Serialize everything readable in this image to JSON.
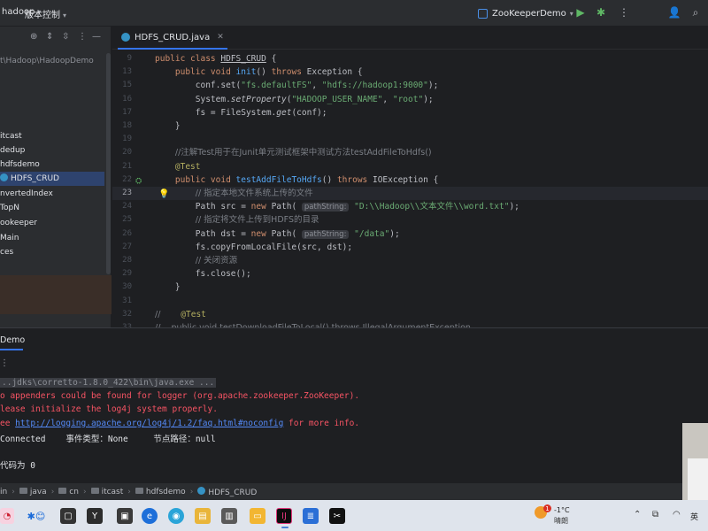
{
  "titlebar": {
    "menu": [
      "hadoop",
      "版本控制"
    ],
    "run_config": "ZooKeeperDemo"
  },
  "project": {
    "path": "t\\Hadoop\\HadoopDemo",
    "tree": [
      {
        "label": "itcast",
        "selected": false
      },
      {
        "label": "dedup",
        "selected": false
      },
      {
        "label": "hdfsdemo",
        "selected": false
      },
      {
        "label": "HDFS_CRUD",
        "selected": true
      },
      {
        "label": "nvertedIndex",
        "selected": false
      },
      {
        "label": "TopN",
        "selected": false
      },
      {
        "label": "ookeeper",
        "selected": false
      },
      {
        "label": "Main",
        "selected": false
      },
      {
        "label": "ces",
        "selected": false
      }
    ]
  },
  "editor": {
    "tab": "HDFS_CRUD.java",
    "lines": [
      {
        "n": "9",
        "segs": [
          [
            "kw",
            "public class "
          ],
          [
            "cls",
            "HDFS_CRUD"
          ],
          [
            "pl",
            " {"
          ]
        ]
      },
      {
        "n": "13",
        "segs": [
          [
            "pl",
            "    "
          ],
          [
            "kw",
            "public void "
          ],
          [
            "fn",
            "init"
          ],
          [
            "pl",
            "() "
          ],
          [
            "kw",
            "throws "
          ],
          [
            "pl",
            "Exception {"
          ]
        ]
      },
      {
        "n": "15",
        "segs": [
          [
            "pl",
            "        conf.set("
          ],
          [
            "str",
            "\"fs.defaultFS\""
          ],
          [
            "pl",
            ", "
          ],
          [
            "str",
            "\"hdfs://hadoop1:9000\""
          ],
          [
            "pl",
            ");"
          ]
        ]
      },
      {
        "n": "16",
        "segs": [
          [
            "pl",
            "        System."
          ],
          [
            "it",
            "setProperty"
          ],
          [
            "pl",
            "("
          ],
          [
            "str",
            "\"HADOOP_USER_NAME\""
          ],
          [
            "pl",
            ", "
          ],
          [
            "str",
            "\"root\""
          ],
          [
            "pl",
            ");"
          ]
        ]
      },
      {
        "n": "17",
        "segs": [
          [
            "pl",
            "        fs = FileSystem."
          ],
          [
            "it",
            "get"
          ],
          [
            "pl",
            "(conf);"
          ]
        ]
      },
      {
        "n": "18",
        "segs": [
          [
            "pl",
            "    }"
          ]
        ]
      },
      {
        "n": "19",
        "segs": []
      },
      {
        "n": "20",
        "segs": [
          [
            "pl",
            "    "
          ],
          [
            "cmt",
            "//注解Test用于在Junit单元测试框架中测试方法testAddFileToHdfs()"
          ]
        ]
      },
      {
        "n": "21",
        "segs": [
          [
            "pl",
            "    "
          ],
          [
            "ann",
            "@Test"
          ]
        ]
      },
      {
        "n": "22",
        "segs": [
          [
            "pl",
            "    "
          ],
          [
            "kw",
            "public void "
          ],
          [
            "fn",
            "testAddFileToHdfs"
          ],
          [
            "pl",
            "() "
          ],
          [
            "kw",
            "throws "
          ],
          [
            "pl",
            "IOException {"
          ]
        ]
      },
      {
        "n": "23",
        "segs": [
          [
            "pl",
            "        "
          ],
          [
            "cmt",
            "// 指定本地文件系统上传的文件"
          ]
        ],
        "current": true
      },
      {
        "n": "24",
        "segs": [
          [
            "pl",
            "        Path src = "
          ],
          [
            "kw",
            "new "
          ],
          [
            "pl",
            "Path( "
          ],
          [
            "hint",
            "pathString:"
          ],
          [
            "str",
            " \"D:\\\\Hadoop\\\\文本文件\\\\word.txt\""
          ],
          [
            "pl",
            ");"
          ]
        ]
      },
      {
        "n": "25",
        "segs": [
          [
            "pl",
            "        "
          ],
          [
            "cmt",
            "// 指定将文件上传到HDFS的目录"
          ]
        ]
      },
      {
        "n": "26",
        "segs": [
          [
            "pl",
            "        Path dst = "
          ],
          [
            "kw",
            "new "
          ],
          [
            "pl",
            "Path( "
          ],
          [
            "hint",
            "pathString:"
          ],
          [
            "str",
            " \"/data\""
          ],
          [
            "pl",
            ");"
          ]
        ]
      },
      {
        "n": "27",
        "segs": [
          [
            "pl",
            "        fs.copyFromLocalFile(src, dst);"
          ]
        ]
      },
      {
        "n": "28",
        "segs": [
          [
            "pl",
            "        "
          ],
          [
            "cmt",
            "// 关闭资源"
          ]
        ]
      },
      {
        "n": "29",
        "segs": [
          [
            "pl",
            "        fs.close();"
          ]
        ]
      },
      {
        "n": "30",
        "segs": [
          [
            "pl",
            "    }"
          ]
        ]
      },
      {
        "n": "31",
        "segs": []
      },
      {
        "n": "32",
        "segs": [
          [
            "cmt",
            "//"
          ],
          [
            "pl",
            "    "
          ],
          [
            "ann",
            "@Test"
          ]
        ]
      },
      {
        "n": "33",
        "segs": [
          [
            "cmt",
            "//    public void testDownloadFileToLocal() throws IllegalArgumentException"
          ]
        ]
      }
    ]
  },
  "run": {
    "tab": "Demo",
    "console": [
      {
        "type": "cmd",
        "text": "..jdks\\corretto-1.8.0_422\\bin\\java.exe ..."
      },
      {
        "type": "err",
        "text": "o appenders could be found for logger (org.apache.zookeeper.ZooKeeper)."
      },
      {
        "type": "err",
        "text": "lease initialize the log4j system properly."
      },
      {
        "type": "errlink",
        "pre": "ee ",
        "link": "http://logging.apache.org/log4j/1.2/faq.html#noconfig",
        "post": " for more info."
      },
      {
        "type": "out",
        "text": "Connected    事件类型：None     节点路径：null"
      },
      {
        "type": "blank",
        "text": ""
      },
      {
        "type": "out",
        "text": "代码为 0"
      }
    ]
  },
  "breadcrumb": [
    "in",
    "java",
    "cn",
    "itcast",
    "hdfsdemo",
    "HDFS_CRUD"
  ],
  "taskbar": {
    "weather_temp": "-1°C",
    "weather_desc": "晴朗",
    "weather_badge": "1",
    "lang": "英"
  }
}
